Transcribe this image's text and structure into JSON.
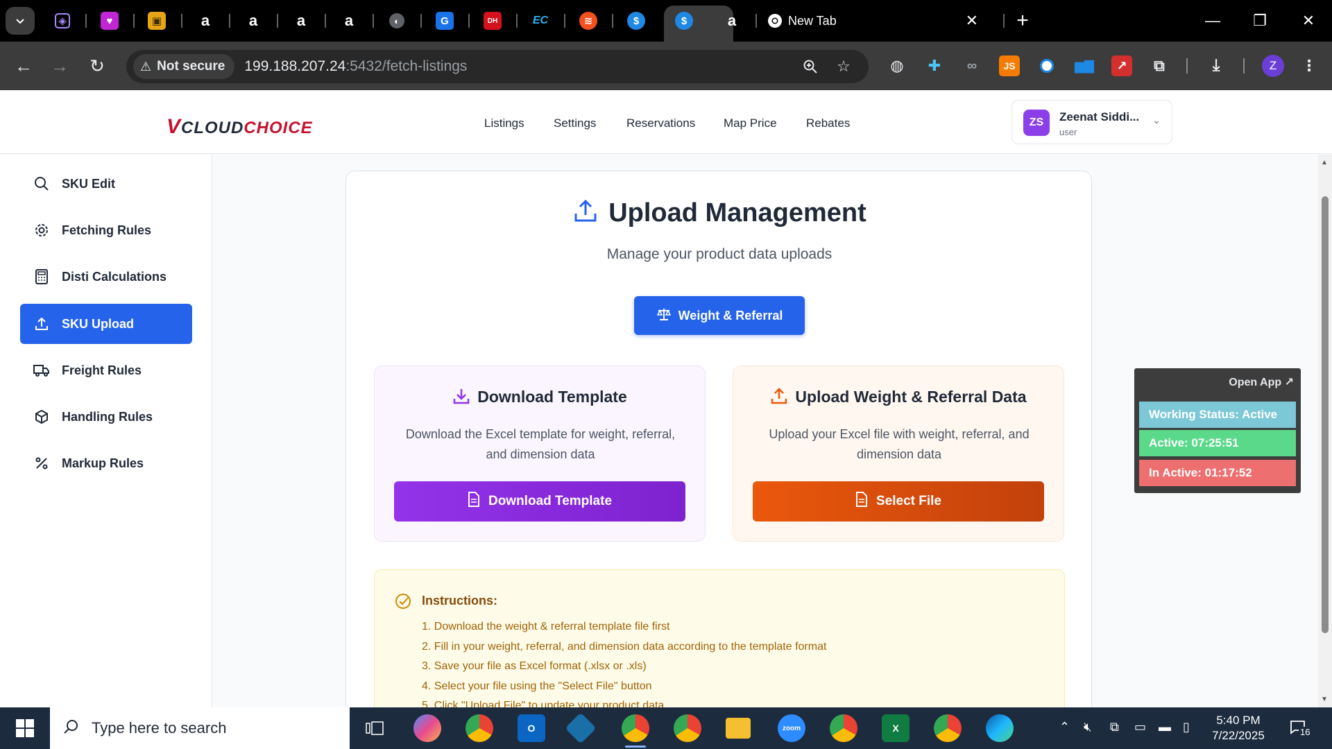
{
  "browser": {
    "new_tab_title": "New Tab",
    "security_label": "Not secure",
    "url_host": "199.188.207.24",
    "url_path": ":5432/fetch-listings",
    "profile_initial": "Z"
  },
  "header": {
    "logo_v": "V",
    "logo_cloud": "CLOUD",
    "logo_choice": "CHOICE",
    "nav": [
      "Listings",
      "Settings",
      "Reservations",
      "Map Price",
      "Rebates"
    ],
    "user": {
      "initials": "ZS",
      "name": "Zeenat Siddi...",
      "role": "user"
    }
  },
  "sidebar": {
    "items": [
      {
        "label": "SKU Edit",
        "icon": "search-icon"
      },
      {
        "label": "Fetching Rules",
        "icon": "gear-icon"
      },
      {
        "label": "Disti Calculations",
        "icon": "calculator-icon"
      },
      {
        "label": "SKU Upload",
        "icon": "upload-icon",
        "active": true
      },
      {
        "label": "Freight Rules",
        "icon": "truck-icon"
      },
      {
        "label": "Handling Rules",
        "icon": "package-icon"
      },
      {
        "label": "Markup Rules",
        "icon": "percent-icon"
      }
    ]
  },
  "main": {
    "title": "Upload Management",
    "subtitle": "Manage your product data uploads",
    "weight_referral_button": "Weight & Referral",
    "download_panel": {
      "title": "Download Template",
      "description": "Download the Excel template for weight, referral, and dimension data",
      "button": "Download Template"
    },
    "upload_panel": {
      "title": "Upload Weight & Referral Data",
      "description": "Upload your Excel file with weight, referral, and dimension data",
      "button": "Select File"
    },
    "instructions": {
      "title": "Instructions:",
      "steps": [
        "1. Download the weight & referral template file first",
        "2. Fill in your weight, referral, and dimension data according to the template format",
        "3. Save your file as Excel format (.xlsx or .xls)",
        "4. Select your file using the \"Select File\" button",
        "5. Click \"Upload File\" to update your product data"
      ]
    }
  },
  "status_widget": {
    "open_app": "Open App ↗",
    "working_status": "Working Status: Active",
    "active": "Active: 07:25:51",
    "inactive": "In Active: 01:17:52"
  },
  "taskbar": {
    "search_placeholder": "Type here to search",
    "time": "5:40 PM",
    "date": "7/22/2025",
    "notification_count": "16"
  },
  "colors": {
    "primary": "#2563eb",
    "purple": "#9333ea",
    "orange": "#ea580c",
    "brand_red": "#c8102e"
  }
}
